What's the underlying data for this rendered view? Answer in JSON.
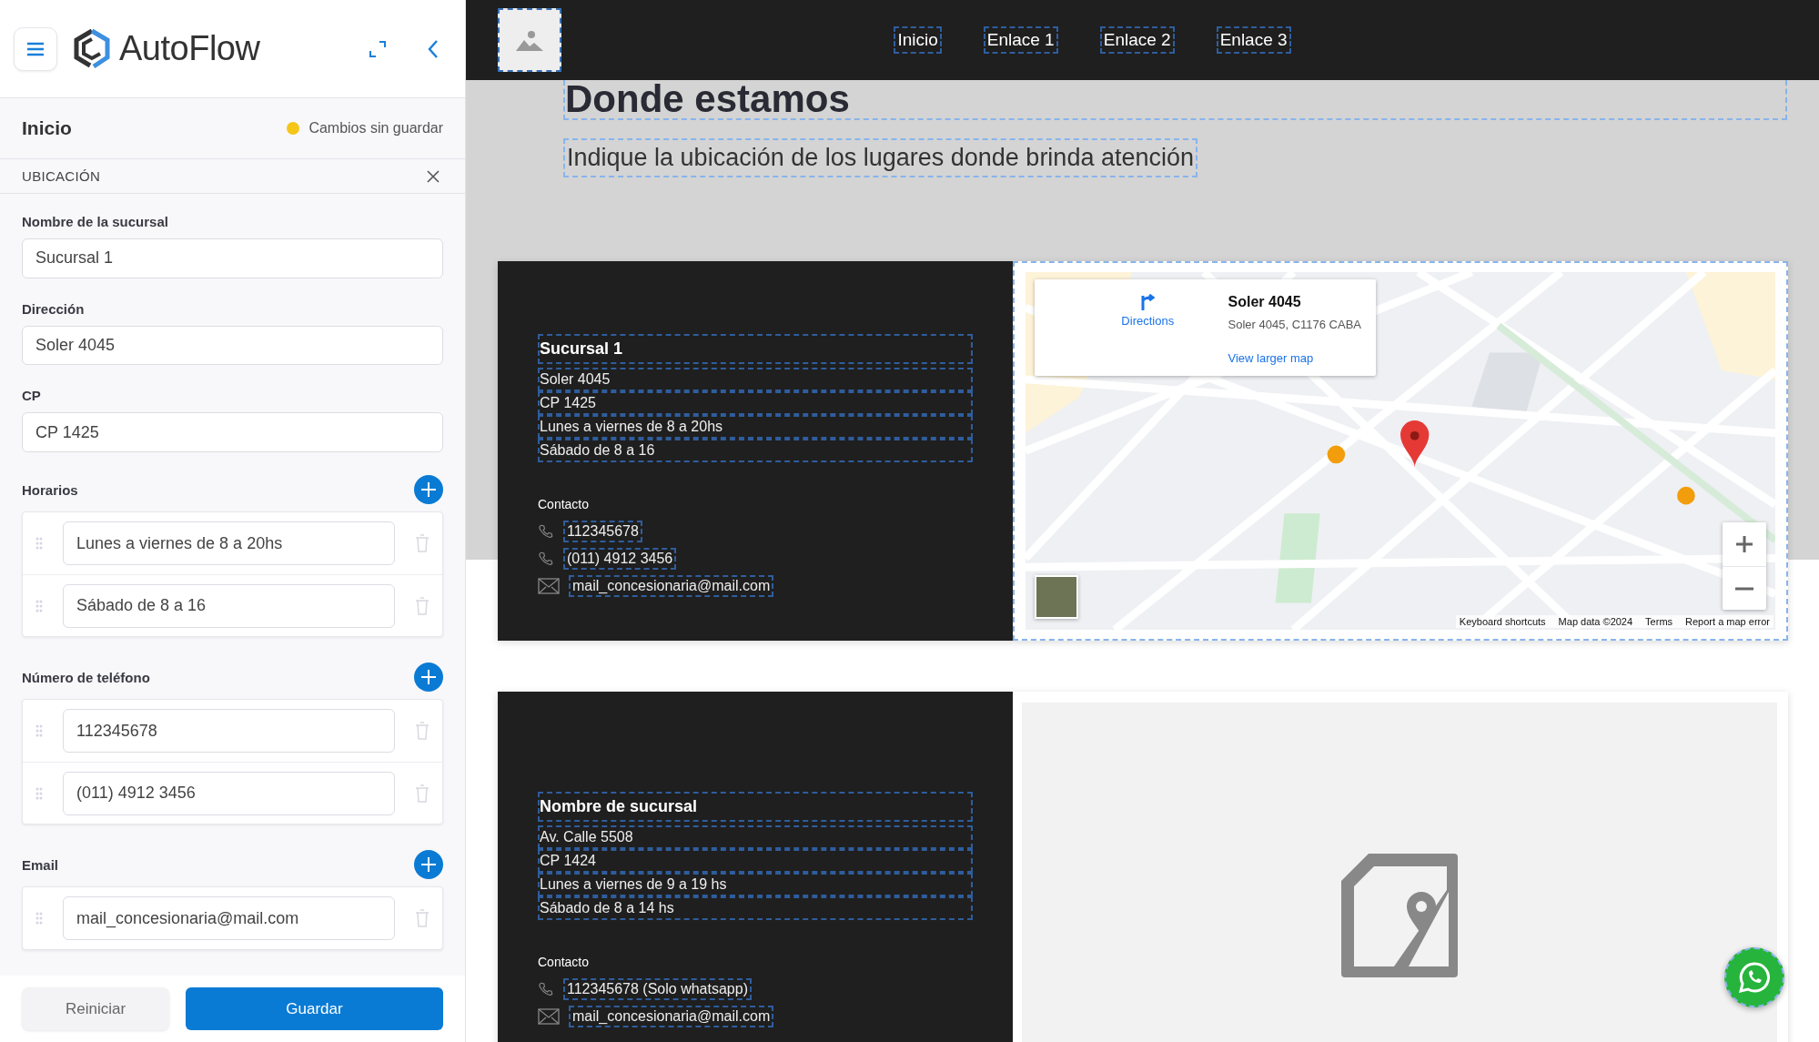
{
  "sidebar": {
    "logo": "AutoFlow",
    "page_title": "Inicio",
    "status": {
      "text": "Cambios sin guardar",
      "color": "#f5c518"
    },
    "section": "UBICACIÓN",
    "fields": [
      {
        "label": "Nombre de la sucursal",
        "value": "Sucursal 1"
      },
      {
        "label": "Dirección",
        "value": "Soler 4045"
      },
      {
        "label": "CP",
        "value": "CP 1425"
      }
    ],
    "lists": [
      {
        "label": "Horarios",
        "items": [
          "Lunes a viernes de 8 a 20hs",
          "Sábado de 8 a 16"
        ]
      },
      {
        "label": "Número de teléfono",
        "items": [
          "112345678",
          "(011) 4912 3456"
        ]
      },
      {
        "label": "Email",
        "items": [
          "mail_concesionaria@mail.com"
        ]
      }
    ],
    "buttons": {
      "reset": "Reiniciar",
      "save": "Guardar"
    }
  },
  "nav": {
    "links": [
      "Inicio",
      "Enlace 1",
      "Enlace 2",
      "Enlace 3"
    ]
  },
  "page": {
    "title": "Donde estamos",
    "subtitle": "Indique la ubicación de los lugares donde brinda atención"
  },
  "branches": [
    {
      "name": "Sucursal 1",
      "lines": [
        "Soler 4045",
        "CP 1425",
        "Lunes a viernes de 8 a 20hs",
        "Sábado de 8 a 16"
      ],
      "contact_label": "Contacto",
      "contacts": [
        {
          "kind": "phone",
          "text": "112345678"
        },
        {
          "kind": "phone",
          "text": "(011) 4912 3456"
        },
        {
          "kind": "email",
          "text": "mail_concesionaria@mail.com"
        }
      ],
      "map": {
        "kind": "embed",
        "place": "Soler 4045",
        "address": "Soler 4045, C1176 CABA",
        "directions": "Directions",
        "larger": "View larger map",
        "footer": [
          "Keyboard shortcuts",
          "Map data ©2024",
          "Terms",
          "Report a map error"
        ]
      }
    },
    {
      "name": "Nombre de sucursal",
      "lines": [
        "Av. Calle 5508",
        "CP 1424",
        "Lunes a viernes de 9 a 19 hs",
        "Sábado de 8 a 14 hs"
      ],
      "contact_label": "Contacto",
      "contacts": [
        {
          "kind": "phone",
          "text": "112345678 (Solo whatsapp)"
        },
        {
          "kind": "email",
          "text": "mail_concesionaria@mail.com"
        }
      ],
      "map": {
        "kind": "placeholder"
      }
    }
  ]
}
